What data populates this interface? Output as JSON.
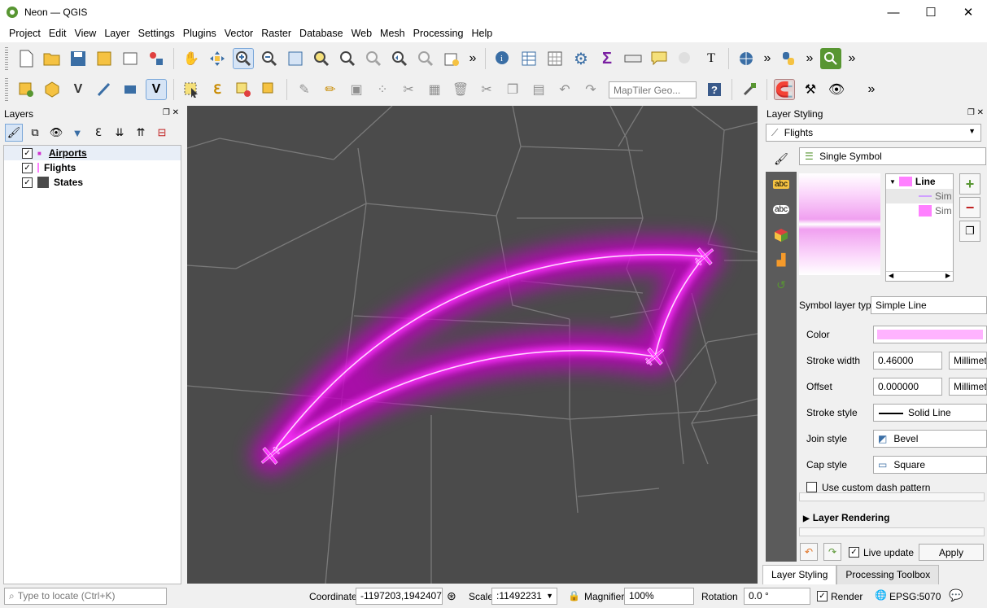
{
  "window": {
    "title": "Neon — QGIS",
    "minimize": "—",
    "maximize": "☐",
    "close": "✕"
  },
  "menu": [
    "Project",
    "Edit",
    "View",
    "Layer",
    "Settings",
    "Plugins",
    "Vector",
    "Raster",
    "Database",
    "Web",
    "Mesh",
    "Processing",
    "Help"
  ],
  "toolbar2": {
    "search_placeholder": "MapTiler Geo..."
  },
  "layers_panel": {
    "title": "Layers",
    "layers": [
      {
        "name": "Airports",
        "checked": true,
        "symbol": "point",
        "bold_underline": true
      },
      {
        "name": "Flights",
        "checked": true,
        "symbol": "line"
      },
      {
        "name": "States",
        "checked": true,
        "symbol": "polygon"
      }
    ]
  },
  "styling_panel": {
    "title": "Layer Styling",
    "selected_layer": "Flights",
    "renderer": "Single Symbol",
    "tree": {
      "root": "Line",
      "children": [
        "Sim",
        "Sim"
      ]
    },
    "symbol_layer_type_label": "Symbol layer type",
    "symbol_layer_type": "Simple Line",
    "color_label": "Color",
    "stroke_width_label": "Stroke width",
    "stroke_width": "0.46000",
    "stroke_width_unit": "Millimete",
    "offset_label": "Offset",
    "offset": "0.000000",
    "offset_unit": "Millimete",
    "stroke_style_label": "Stroke style",
    "stroke_style": "Solid Line",
    "join_style_label": "Join style",
    "join_style": "Bevel",
    "cap_style_label": "Cap style",
    "cap_style": "Square",
    "custom_dash_label": "Use custom dash pattern",
    "layer_rendering": "Layer Rendering",
    "live_update": "Live update",
    "apply": "Apply",
    "color_value": "#ffb3ff"
  },
  "bottom_tabs": [
    "Layer Styling",
    "Processing Toolbox"
  ],
  "status": {
    "locate_placeholder": "Type to locate (Ctrl+K)",
    "coordinate_label": "Coordinate",
    "coordinate": "-1197203,1942407",
    "scale_label": "Scale",
    "scale": ":11492231",
    "magnifier_label": "Magnifier",
    "magnifier": "100%",
    "rotation_label": "Rotation",
    "rotation": "0.0 °",
    "render_label": "Render",
    "crs": "EPSG:5070"
  },
  "colors": {
    "map_bg": "#4b4b4b",
    "state_lines": "#7a7a7a",
    "neon": "#ff33ff",
    "glow": "#c000c0"
  }
}
